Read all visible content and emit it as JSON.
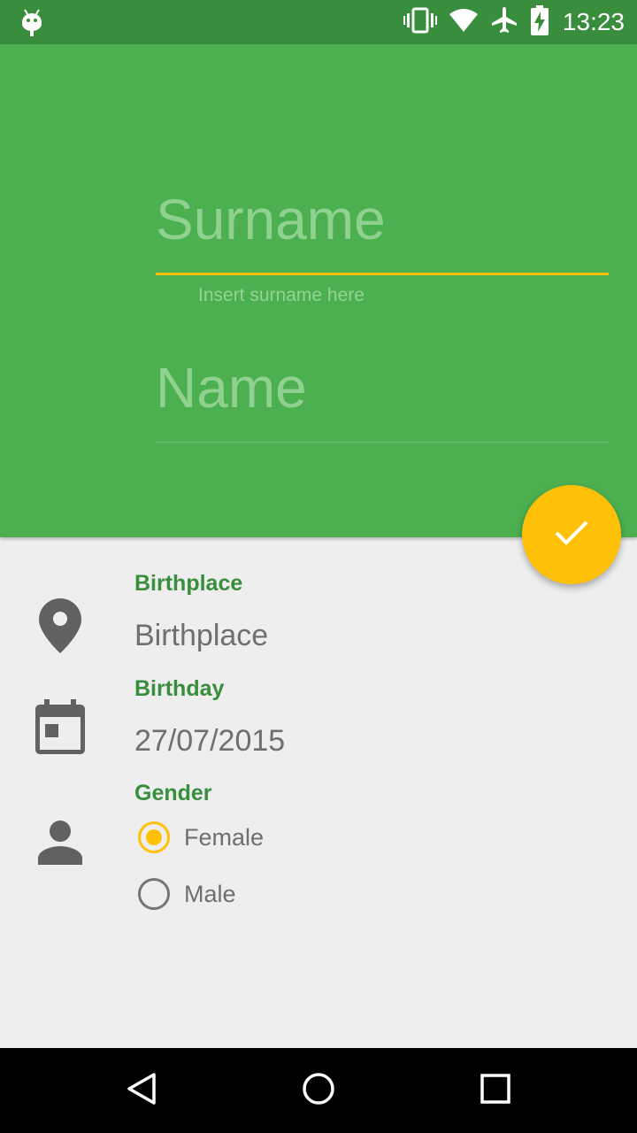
{
  "status_bar": {
    "time": "13:23",
    "icons": [
      "android-debug-icon",
      "vibrate-icon",
      "wifi-icon",
      "airplane-mode-icon",
      "battery-charging-icon"
    ]
  },
  "header": {
    "surname_placeholder": "Surname",
    "surname_hint": "Insert surname here",
    "name_placeholder": "Name"
  },
  "fab": {
    "icon": "check-icon"
  },
  "form": {
    "birthplace": {
      "label": "Birthplace",
      "value": "Birthplace",
      "icon": "location-pin-icon"
    },
    "birthday": {
      "label": "Birthday",
      "value": "27/07/2015",
      "icon": "calendar-icon"
    },
    "gender": {
      "label": "Gender",
      "icon": "person-icon",
      "options": [
        {
          "label": "Female",
          "selected": true
        },
        {
          "label": "Male",
          "selected": false
        }
      ]
    }
  },
  "colors": {
    "primary": "#4caf50",
    "primary_dark": "#388e3c",
    "accent": "#ffc107",
    "background": "#eeeeee"
  },
  "nav_bar": {
    "icons": [
      "back-icon",
      "home-icon",
      "recents-icon"
    ]
  }
}
